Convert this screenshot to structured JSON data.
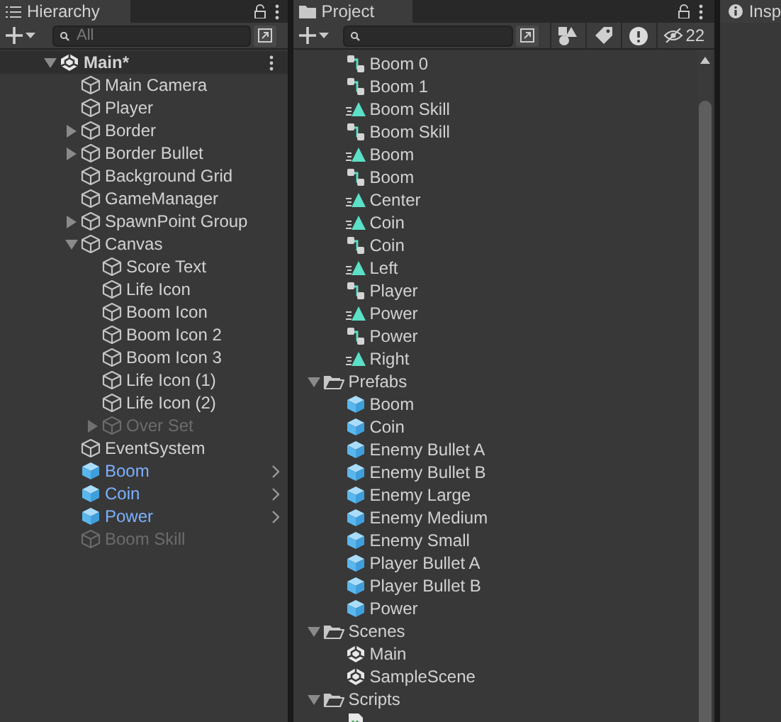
{
  "hierarchy": {
    "title": "Hierarchy",
    "search": {
      "placeholder": "All"
    },
    "scene": {
      "label": "Main*",
      "expanded": true,
      "children": [
        {
          "label": "Main Camera",
          "kind": "object",
          "disabled": false
        },
        {
          "label": "Player",
          "kind": "object",
          "disabled": false
        },
        {
          "label": "Border",
          "kind": "group",
          "expanded": false,
          "disabled": false
        },
        {
          "label": "Border Bullet",
          "kind": "group",
          "expanded": false,
          "disabled": false
        },
        {
          "label": "Background Grid",
          "kind": "object",
          "disabled": false
        },
        {
          "label": "GameManager",
          "kind": "object",
          "disabled": false
        },
        {
          "label": "SpawnPoint Group",
          "kind": "group",
          "expanded": false,
          "disabled": false
        },
        {
          "label": "Canvas",
          "kind": "group",
          "expanded": true,
          "disabled": false,
          "children": [
            {
              "label": "Score Text",
              "kind": "object",
              "disabled": false
            },
            {
              "label": "Life Icon",
              "kind": "object",
              "disabled": false
            },
            {
              "label": "Boom Icon",
              "kind": "object",
              "disabled": false
            },
            {
              "label": "Boom Icon 2",
              "kind": "object",
              "disabled": false
            },
            {
              "label": "Boom Icon 3",
              "kind": "object",
              "disabled": false
            },
            {
              "label": "Life Icon (1)",
              "kind": "object",
              "disabled": false
            },
            {
              "label": "Life Icon (2)",
              "kind": "object",
              "disabled": false
            },
            {
              "label": "Over Set",
              "kind": "group",
              "expanded": false,
              "disabled": true
            }
          ]
        },
        {
          "label": "EventSystem",
          "kind": "object",
          "disabled": false
        },
        {
          "label": "Boom",
          "kind": "prefab",
          "disabled": false
        },
        {
          "label": "Coin",
          "kind": "prefab",
          "disabled": false
        },
        {
          "label": "Power",
          "kind": "prefab",
          "disabled": false
        },
        {
          "label": "Boom Skill",
          "kind": "object",
          "disabled": true
        }
      ]
    }
  },
  "project": {
    "title": "Project",
    "hidden_count": "22",
    "loose_items": [
      {
        "label": "Boom 0",
        "kind": "controller"
      },
      {
        "label": "Boom 1",
        "kind": "controller"
      },
      {
        "label": "Boom Skill",
        "kind": "animation"
      },
      {
        "label": "Boom Skill",
        "kind": "controller"
      },
      {
        "label": "Boom",
        "kind": "animation"
      },
      {
        "label": "Boom",
        "kind": "controller"
      },
      {
        "label": "Center",
        "kind": "animation"
      },
      {
        "label": "Coin",
        "kind": "animation"
      },
      {
        "label": "Coin",
        "kind": "controller"
      },
      {
        "label": "Left",
        "kind": "animation"
      },
      {
        "label": "Player",
        "kind": "controller"
      },
      {
        "label": "Power",
        "kind": "animation"
      },
      {
        "label": "Power",
        "kind": "controller"
      },
      {
        "label": "Right",
        "kind": "animation"
      }
    ],
    "folders": [
      {
        "label": "Prefabs",
        "expanded": true,
        "children": [
          {
            "label": "Boom",
            "kind": "prefab"
          },
          {
            "label": "Coin",
            "kind": "prefab"
          },
          {
            "label": "Enemy Bullet A",
            "kind": "prefab"
          },
          {
            "label": "Enemy Bullet B",
            "kind": "prefab"
          },
          {
            "label": "Enemy Large",
            "kind": "prefab"
          },
          {
            "label": "Enemy Medium",
            "kind": "prefab"
          },
          {
            "label": "Enemy Small",
            "kind": "prefab"
          },
          {
            "label": "Player Bullet A",
            "kind": "prefab"
          },
          {
            "label": "Player Bullet B",
            "kind": "prefab"
          },
          {
            "label": "Power",
            "kind": "prefab"
          }
        ]
      },
      {
        "label": "Scenes",
        "expanded": true,
        "children": [
          {
            "label": "Main",
            "kind": "scene"
          },
          {
            "label": "SampleScene",
            "kind": "scene"
          }
        ]
      },
      {
        "label": "Scripts",
        "expanded": true,
        "children": [
          {
            "kind": "script"
          }
        ]
      }
    ]
  },
  "inspector": {
    "title": "Insp"
  }
}
